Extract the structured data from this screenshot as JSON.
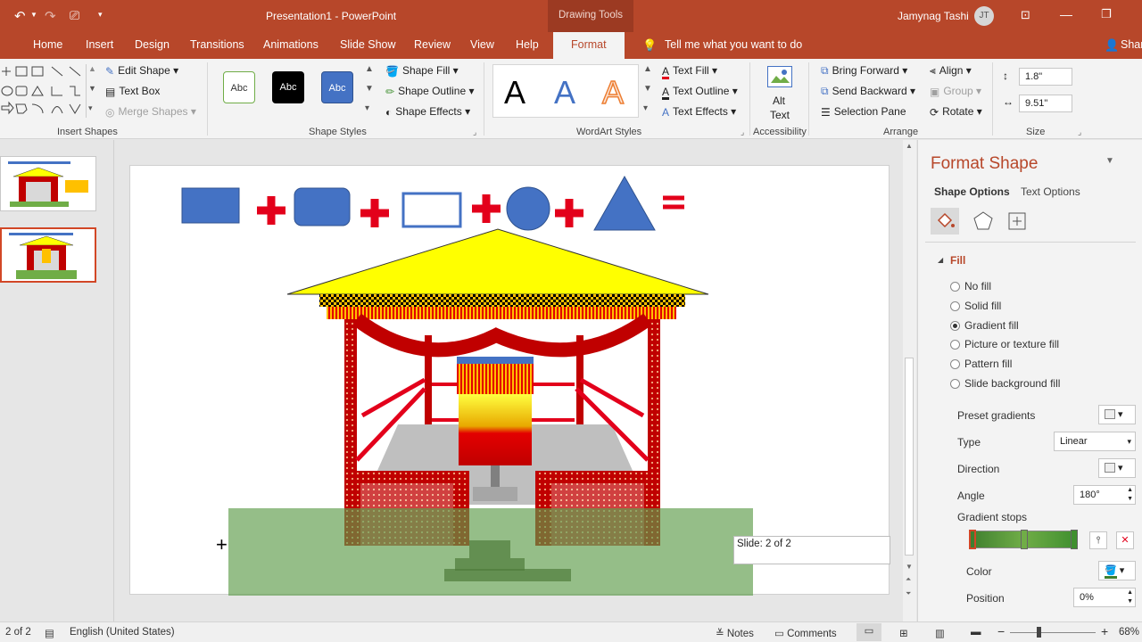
{
  "titlebar": {
    "doc_title": "Presentation1  -  PowerPoint",
    "context_tool": "Drawing Tools",
    "user_name": "Jamynag Tashi",
    "user_initials": "JT"
  },
  "tabs": {
    "items": [
      "Home",
      "Insert",
      "Design",
      "Transitions",
      "Animations",
      "Slide Show",
      "Review",
      "View",
      "Help"
    ],
    "active": "Format",
    "tell_me": "Tell me what you want to do",
    "share": "Share"
  },
  "ribbon": {
    "insert_shapes": {
      "label": "Insert Shapes",
      "edit_shape": "Edit Shape",
      "text_box": "Text Box",
      "merge_shapes": "Merge Shapes"
    },
    "shape_styles": {
      "label": "Shape Styles",
      "swatch_text": "Abc",
      "shape_fill": "Shape Fill",
      "shape_outline": "Shape Outline",
      "shape_effects": "Shape Effects"
    },
    "wordart": {
      "label": "WordArt Styles",
      "letter": "A",
      "text_fill": "Text Fill",
      "text_outline": "Text Outline",
      "text_effects": "Text Effects"
    },
    "accessibility": {
      "label": "Accessibility",
      "alt": "Alt",
      "text": "Text"
    },
    "arrange": {
      "label": "Arrange",
      "bring_forward": "Bring Forward",
      "send_backward": "Send Backward",
      "selection_pane": "Selection Pane",
      "align": "Align",
      "group": "Group",
      "rotate": "Rotate"
    },
    "size": {
      "label": "Size",
      "height": "1.8\"",
      "width": "9.51\""
    }
  },
  "slide_tooltip": "Slide: 2 of 2",
  "format_pane": {
    "title": "Format Shape",
    "tab_shape": "Shape Options",
    "tab_text": "Text Options",
    "section": "Fill",
    "options": [
      "No fill",
      "Solid fill",
      "Gradient fill",
      "Picture or texture fill",
      "Pattern fill",
      "Slide background fill"
    ],
    "selected_index": 2,
    "preset_gradients": "Preset gradients",
    "type_label": "Type",
    "type_value": "Linear",
    "direction_label": "Direction",
    "angle_label": "Angle",
    "angle_value": "180°",
    "stops_label": "Gradient stops",
    "color_label": "Color",
    "position_label": "Position",
    "position_value": "0%"
  },
  "statusbar": {
    "slide": "2 of 2",
    "language": "English (United States)",
    "notes": "Notes",
    "comments": "Comments",
    "zoom": "68%"
  },
  "colors": {
    "accent": "#b7472a",
    "shape_blue": "#4472c4",
    "plus_red": "#e3001b",
    "roof_yellow": "#ffff00",
    "gradient_green": "#3f8f2f"
  }
}
